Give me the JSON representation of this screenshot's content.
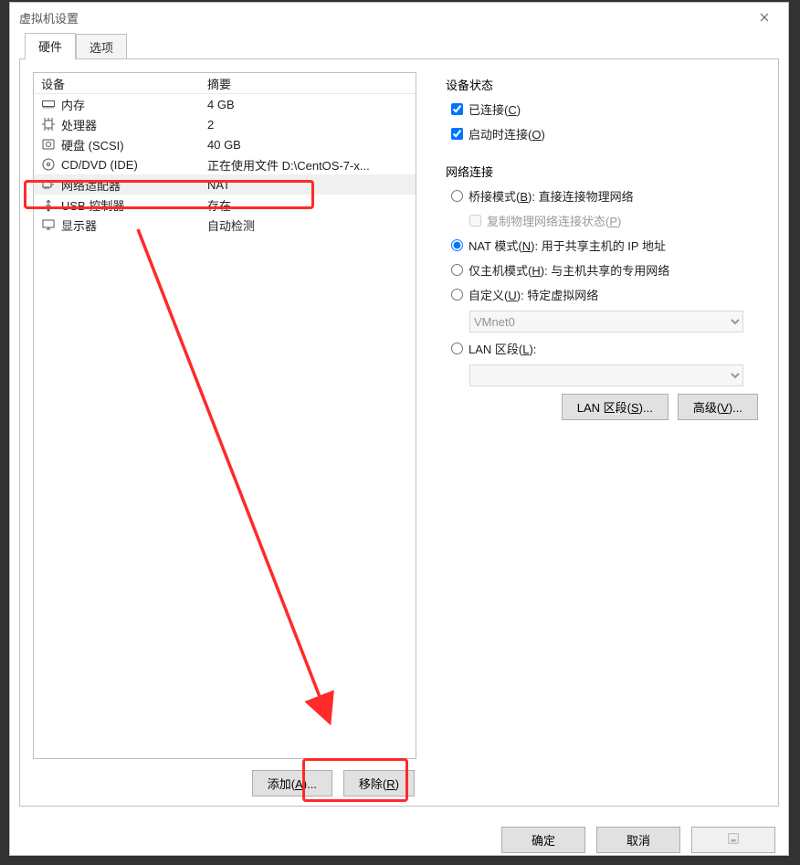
{
  "window": {
    "title": "虚拟机设置"
  },
  "tabs": {
    "hardware": "硬件",
    "options": "选项"
  },
  "device_list": {
    "header_device": "设备",
    "header_summary": "摘要",
    "rows": [
      {
        "id": "memory",
        "label": "内存",
        "summary": "4 GB"
      },
      {
        "id": "cpu",
        "label": "处理器",
        "summary": "2"
      },
      {
        "id": "disk",
        "label": "硬盘 (SCSI)",
        "summary": "40 GB"
      },
      {
        "id": "cd",
        "label": "CD/DVD (IDE)",
        "summary": "正在使用文件 D:\\CentOS-7-x..."
      },
      {
        "id": "net",
        "label": "网络适配器",
        "summary": "NAT",
        "selected": true
      },
      {
        "id": "usb",
        "label": "USB 控制器",
        "summary": "存在"
      },
      {
        "id": "display",
        "label": "显示器",
        "summary": "自动检测"
      }
    ]
  },
  "buttons": {
    "add": {
      "text": "添加(",
      "hotkey": "A",
      "tail": ")..."
    },
    "remove": {
      "text": "移除(",
      "hotkey": "R",
      "tail": ")"
    },
    "lanseg": {
      "text": "LAN 区段(",
      "hotkey": "S",
      "tail": ")..."
    },
    "advanced": {
      "text": "高级(",
      "hotkey": "V",
      "tail": ")..."
    },
    "ok": "确定",
    "cancel": "取消",
    "help": ""
  },
  "right": {
    "device_state": {
      "title": "设备状态",
      "connected": {
        "text": "已连接(",
        "hotkey": "C",
        "tail": ")",
        "checked": true
      },
      "connect_at_start": {
        "text": "启动时连接(",
        "hotkey": "O",
        "tail": ")",
        "checked": true
      }
    },
    "network": {
      "title": "网络连接",
      "bridged": {
        "text": "桥接模式(",
        "hotkey": "B",
        "tail": "): 直接连接物理网络"
      },
      "replicate": {
        "text": "复制物理网络连接状态(",
        "hotkey": "P",
        "tail": ")"
      },
      "nat": {
        "text": "NAT 模式(",
        "hotkey": "N",
        "tail": "): 用于共享主机的 IP 地址",
        "selected": true
      },
      "hostonly": {
        "text": "仅主机模式(",
        "hotkey": "H",
        "tail": "): 与主机共享的专用网络"
      },
      "custom": {
        "text": "自定义(",
        "hotkey": "U",
        "tail": "): 特定虚拟网络"
      },
      "custom_value": "VMnet0",
      "lan": {
        "text": "LAN 区段(",
        "hotkey": "L",
        "tail": "):"
      },
      "lan_value": ""
    }
  }
}
